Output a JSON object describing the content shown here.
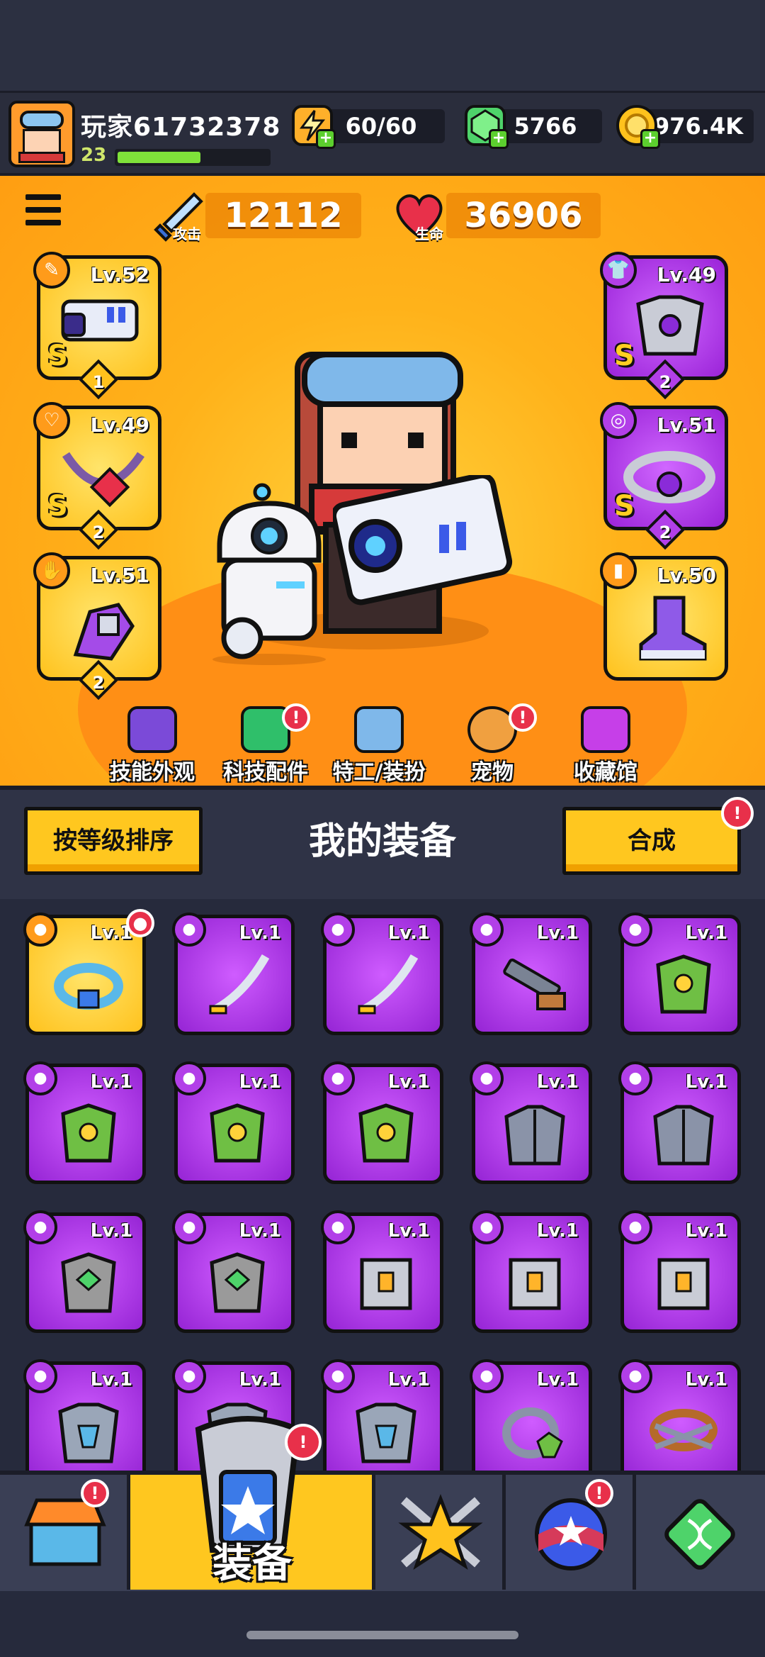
{
  "player": {
    "name": "玩家61732378",
    "level": "23",
    "xp_fraction": 0.55
  },
  "resources": [
    {
      "name": "energy",
      "icon": "energy-icon",
      "value": "60/60"
    },
    {
      "name": "gems",
      "icon": "gem-icon",
      "value": "5766"
    },
    {
      "name": "coins",
      "icon": "coin-icon",
      "value": "976.4K"
    }
  ],
  "stats": {
    "attack": {
      "label": "攻击",
      "value": "12112",
      "icon": "sword-icon"
    },
    "health": {
      "label": "生命",
      "value": "36906",
      "icon": "heart-icon"
    }
  },
  "equipped": {
    "left": [
      {
        "slot": "weapon",
        "level": "Lv.52",
        "rank": "S",
        "stars": "1",
        "rarity": "gold"
      },
      {
        "slot": "necklace",
        "level": "Lv.49",
        "rank": "S",
        "stars": "2",
        "rarity": "gold"
      },
      {
        "slot": "gloves",
        "level": "Lv.51",
        "rank": "",
        "stars": "2",
        "rarity": "gold"
      }
    ],
    "right": [
      {
        "slot": "armor",
        "level": "Lv.49",
        "rank": "S",
        "stars": "2",
        "rarity": "purple"
      },
      {
        "slot": "belt",
        "level": "Lv.51",
        "rank": "S",
        "stars": "2",
        "rarity": "purple"
      },
      {
        "slot": "boots",
        "level": "Lv.50",
        "rank": "",
        "stars": "",
        "rarity": "gold"
      }
    ]
  },
  "feature_nav": [
    {
      "label": "技能外观",
      "badge": false,
      "icon": "skill-skin-icon"
    },
    {
      "label": "科技配件",
      "badge": true,
      "icon": "tech-part-icon"
    },
    {
      "label": "特工/装扮",
      "badge": false,
      "icon": "agent-icon"
    },
    {
      "label": "宠物",
      "badge": true,
      "icon": "pet-icon"
    },
    {
      "label": "收藏馆",
      "badge": false,
      "icon": "collection-icon"
    }
  ],
  "panel": {
    "sort_label": "按等级排序",
    "title": "我的装备",
    "merge_label": "合成",
    "badge": "!"
  },
  "inventory": [
    {
      "level": "Lv.1",
      "item": "belt",
      "color": "#5ab8e8",
      "rarity": "gold"
    },
    {
      "level": "Lv.1",
      "item": "katana",
      "color": "#dfe6ef",
      "rarity": "purple"
    },
    {
      "level": "Lv.1",
      "item": "katana",
      "color": "#dfe6ef",
      "rarity": "purple"
    },
    {
      "level": "Lv.1",
      "item": "shotgun",
      "color": "#c07a3c",
      "rarity": "purple"
    },
    {
      "level": "Lv.1",
      "item": "leaf-armor",
      "color": "#6fbf44",
      "rarity": "purple"
    },
    {
      "level": "Lv.1",
      "item": "leaf-armor",
      "color": "#6fbf44",
      "rarity": "purple"
    },
    {
      "level": "Lv.1",
      "item": "leaf-armor",
      "color": "#6fbf44",
      "rarity": "purple"
    },
    {
      "level": "Lv.1",
      "item": "leaf-armor",
      "color": "#6fbf44",
      "rarity": "purple"
    },
    {
      "level": "Lv.1",
      "item": "steel-armor",
      "color": "#8a93a8",
      "rarity": "purple"
    },
    {
      "level": "Lv.1",
      "item": "steel-armor",
      "color": "#8a93a8",
      "rarity": "purple"
    },
    {
      "level": "Lv.1",
      "item": "gem-armor",
      "color": "#9a9a9a",
      "rarity": "purple"
    },
    {
      "level": "Lv.1",
      "item": "gem-armor",
      "color": "#9a9a9a",
      "rarity": "purple"
    },
    {
      "level": "Lv.1",
      "item": "plate-armor",
      "color": "#c9ccd6",
      "rarity": "purple"
    },
    {
      "level": "Lv.1",
      "item": "plate-armor",
      "color": "#c9ccd6",
      "rarity": "purple"
    },
    {
      "level": "Lv.1",
      "item": "plate-armor",
      "color": "#c9ccd6",
      "rarity": "purple"
    },
    {
      "level": "Lv.1",
      "item": "vest-armor",
      "color": "#9aa6b8",
      "rarity": "purple"
    },
    {
      "level": "Lv.1",
      "item": "vest-armor",
      "color": "#9aa6b8",
      "rarity": "purple"
    },
    {
      "level": "Lv.1",
      "item": "vest-armor",
      "color": "#9aa6b8",
      "rarity": "purple"
    },
    {
      "level": "Lv.1",
      "item": "ring",
      "color": "#6fbf44",
      "rarity": "purple"
    },
    {
      "level": "Lv.1",
      "item": "rope-belt",
      "color": "#b56a2a",
      "rarity": "purple"
    }
  ],
  "bottom_nav": [
    {
      "name": "shop",
      "icon": "shop-icon",
      "badge": true,
      "label": ""
    },
    {
      "name": "equipment",
      "icon": "equipment-icon",
      "badge": false,
      "label": "装备",
      "active": true
    },
    {
      "name": "battle",
      "icon": "battle-star-icon",
      "badge": false,
      "label": ""
    },
    {
      "name": "challenge",
      "icon": "orb-icon",
      "badge": true,
      "label": ""
    },
    {
      "name": "evolve",
      "icon": "dna-icon",
      "badge": false,
      "label": ""
    }
  ],
  "colors": {
    "gold_card": "#ffc21d",
    "purple_card": "#a42bdc",
    "accent": "#ff9e12",
    "badge": "#e8304a"
  }
}
